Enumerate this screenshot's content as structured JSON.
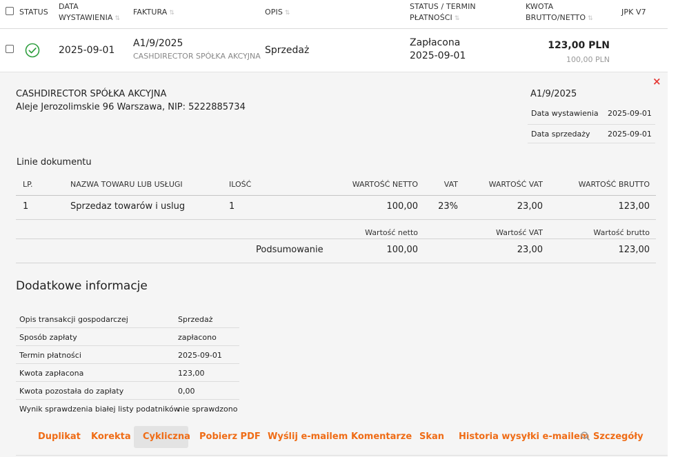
{
  "header": {
    "status": "STATUS",
    "date_l1": "DATA",
    "date_l2": "WYSTAWIENIA",
    "invoice": "FAKTURA",
    "desc": "OPIS",
    "pay_l1": "STATUS / TERMIN",
    "pay_l2": "PŁATNOŚCI",
    "amount_l1": "KWOTA",
    "amount_l2": "BRUTTO/NETTO",
    "jpk": "JPK V7",
    "sort_icon": "⇅"
  },
  "row": {
    "date": "2025-09-01",
    "invoice_no": "A1/9/2025",
    "counterparty": "CASHDIRECTOR SPÓŁKA AKCYJNA",
    "desc": "Sprzedaż",
    "pay_status": "Zapłacona",
    "pay_date": "2025-09-01",
    "gross": "123,00 PLN",
    "net": "100,00 PLN"
  },
  "details": {
    "company_name": "CASHDIRECTOR SPÓŁKA AKCYJNA",
    "company_address": "Aleje Jerozolimskie 96 Warszawa, NIP: 5222885734",
    "doc_number": "A1/9/2025",
    "issue_date_label": "Data wystawienia",
    "issue_date": "2025-09-01",
    "sale_date_label": "Data sprzedaży",
    "sale_date": "2025-09-01",
    "close": "×"
  },
  "lines": {
    "title": "Linie dokumentu",
    "headers": {
      "lp": "LP.",
      "name": "NAZWA TOWARU LUB USŁUGI",
      "qty": "ILOŚĆ",
      "net": "WARTOŚĆ NETTO",
      "vat": "VAT",
      "vat_value": "WARTOŚĆ VAT",
      "gross": "WARTOŚĆ BRUTTO"
    },
    "items": [
      {
        "lp": "1",
        "name": "Sprzedaz towarów i uslug",
        "qty": "1",
        "net": "100,00",
        "vat": "23%",
        "vat_value": "23,00",
        "gross": "123,00"
      }
    ],
    "summary": {
      "net_label": "Wartość netto",
      "vat_label": "Wartość VAT",
      "gross_label": "Wartość brutto",
      "label": "Podsumowanie",
      "net": "100,00",
      "vat": "23,00",
      "gross": "123,00"
    }
  },
  "info": {
    "title": "Dodatkowe informacje",
    "rows": [
      {
        "label": "Opis transakcji gospodarczej",
        "value": "Sprzedaż"
      },
      {
        "label": "Sposób zapłaty",
        "value": "zapłacono"
      },
      {
        "label": "Termin płatności",
        "value": "2025-09-01"
      },
      {
        "label": "Kwota zapłacona",
        "value": "123,00"
      },
      {
        "label": "Kwota pozostała do zapłaty",
        "value": "0,00"
      },
      {
        "label": "Wynik sprawdzenia białej listy podatników",
        "value": "nie sprawdzono"
      }
    ]
  },
  "actions": {
    "duplicate": "Duplikat",
    "correction": "Korekta",
    "recurring": "Cykliczna",
    "pdf": "Pobierz PDF",
    "email": "Wyślij e-mailem",
    "comments": "Komentarze",
    "scan": "Skan",
    "history": "Historia wysyłki e-mailem",
    "details": "Szczegóły"
  },
  "colors": {
    "accent": "#ef6c16",
    "status_ok": "#2e9e3e",
    "close": "#e53935",
    "panel_bg": "#f5f5f5"
  }
}
